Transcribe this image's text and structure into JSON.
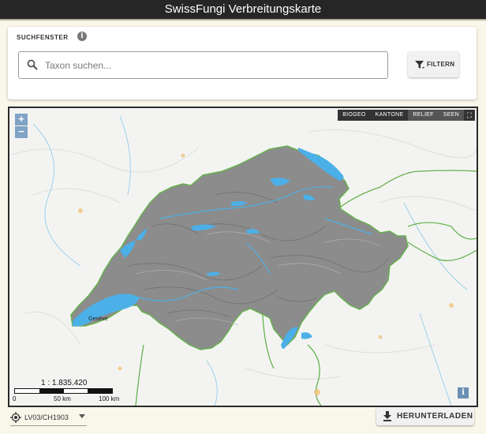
{
  "app": {
    "title": "SwissFungi Verbreitungskarte"
  },
  "search_panel": {
    "title": "SUCHFENSTER",
    "info_glyph": "i",
    "search_placeholder": "Taxon suchen...",
    "filter_label": "FILTERN"
  },
  "map": {
    "zoom_in": "+",
    "zoom_out": "−",
    "layers": [
      {
        "label": "BIOGEO",
        "active": false
      },
      {
        "label": "KANTONE",
        "active": false
      },
      {
        "label": "RELIEF",
        "active": true
      },
      {
        "label": "SEEN",
        "active": true
      }
    ],
    "fullscreen_glyph": "⛶",
    "place_label": "Genève",
    "scale": {
      "ratio": "1 : 1.835.420",
      "ticks": [
        "0",
        "50 km",
        "100 km"
      ]
    },
    "info_glyph": "i"
  },
  "footer": {
    "crs_value": "LV03/CH1903",
    "download_label": "HERUNTERLADEN"
  },
  "colors": {
    "lake": "#4cb0e8",
    "border": "#67b24e",
    "relief": "#8a8a8a",
    "header_bg": "#262626",
    "page_bg": "#f9f6ea"
  }
}
